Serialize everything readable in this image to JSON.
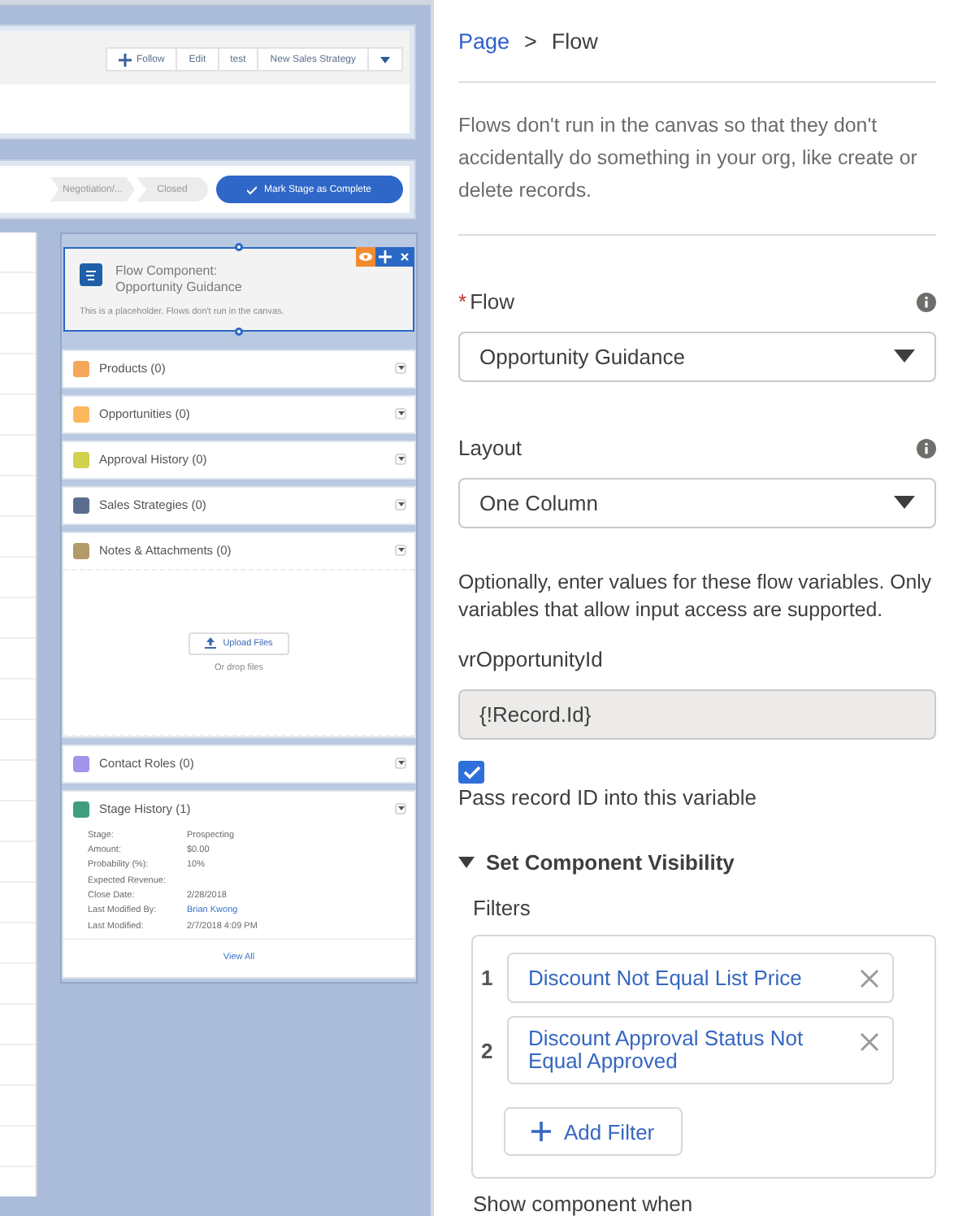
{
  "canvas": {
    "header_buttons": [
      {
        "kind": "follow",
        "label": "Follow"
      },
      {
        "kind": "text",
        "label": "Edit"
      },
      {
        "kind": "text",
        "label": "test"
      },
      {
        "kind": "text",
        "label": "New Sales Strategy"
      },
      {
        "kind": "menu"
      }
    ],
    "path": {
      "stages": [
        "Negotiation/...",
        "Closed"
      ],
      "complete_button": "Mark Stage as Complete"
    },
    "flow_component": {
      "selected": true,
      "title": "Flow Component: Opportunity Guidance",
      "note": "This is a placeholder. Flows don't run in the canvas."
    },
    "related_lists": [
      {
        "kind": "simple",
        "title": "Products (0)",
        "color": "#f5a75a"
      },
      {
        "kind": "simple",
        "title": "Opportunities (0)",
        "color": "#fcb95b"
      },
      {
        "kind": "simple",
        "title": "Approval History (0)",
        "color": "#d1d14f"
      },
      {
        "kind": "simple",
        "title": "Sales Strategies (0)",
        "color": "#5b6d8e"
      },
      {
        "kind": "files",
        "title": "Notes & Attachments (0)",
        "color": "#b49a6a",
        "upload_button": "Upload Files",
        "drop_text": "Or drop files"
      },
      {
        "kind": "simple",
        "title": "Contact Roles (0)",
        "color": "#a094ed"
      },
      {
        "kind": "fields",
        "title": "Stage History (1)",
        "color": "#3f9e80",
        "fields": [
          {
            "label": "Stage:",
            "value": "Prospecting"
          },
          {
            "label": "Amount:",
            "value": "$0.00"
          },
          {
            "label": "Probability (%):",
            "value": "10%"
          },
          {
            "label": "Expected Revenue:"
          },
          {
            "label": "Close Date:",
            "value": "2/28/2018"
          },
          {
            "label": "Last Modified By:",
            "value": "Brian Kwong",
            "kind": "link"
          },
          {
            "label": "Last Modified:",
            "value": "2/7/2018 4:09 PM"
          }
        ],
        "view_all": "View All"
      }
    ]
  },
  "panel": {
    "breadcrumb": {
      "parent": "Page",
      "separator": ">",
      "current": "Flow"
    },
    "notice": "Flows don't run in the canvas so that they don't accidentally do something in your org, like create or delete records.",
    "selects": [
      {
        "required_mark": "*",
        "label": "Flow",
        "value": "Opportunity Guidance"
      },
      {
        "label": "Layout",
        "value": "One Column"
      }
    ],
    "variables_hint": "Optionally, enter values for these flow variables. Only variables that allow input access are supported.",
    "variable": {
      "label": "vrOpportunityId",
      "value": "{!Record.Id}",
      "disabled": true
    },
    "pass_record": {
      "label": "Pass record ID into this variable",
      "checked": true
    },
    "visibility": {
      "title": "Set Component Visibility",
      "expanded": true,
      "filters_label": "Filters",
      "filters": [
        {
          "number": "1",
          "label": "Discount Not Equal List Price"
        },
        {
          "number": "2",
          "label": "Discount Approval Status Not Equal Approved"
        }
      ],
      "add_filter": "Add Filter",
      "next_label": "Show component when"
    }
  }
}
